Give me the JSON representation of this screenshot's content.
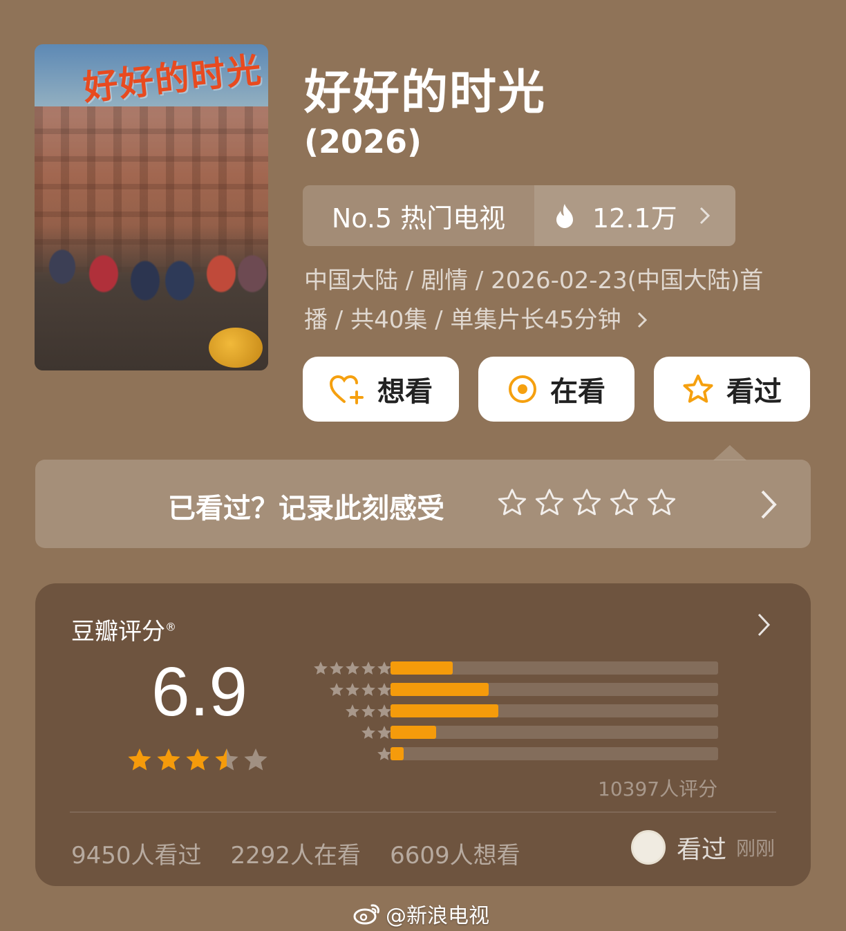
{
  "poster": {
    "title_art": "好好的时光"
  },
  "title": "好好的时光",
  "year": "(2026)",
  "rank": {
    "label": "No.5 热门电视",
    "heat": "12.1万"
  },
  "meta": {
    "line1": "中国大陆 / 剧情 / 2026-02-23(中国大陆)首",
    "line2": "播 / 共40集 / 单集片长45分钟"
  },
  "actions": {
    "want": "想看",
    "watching": "在看",
    "watched": "看过"
  },
  "record": {
    "prompt": "已看过？记录此刻感受"
  },
  "rating": {
    "title": "豆瓣评分",
    "registered": "®",
    "score": "6.9",
    "stars": 3.5,
    "distribution": [
      {
        "stars": 5,
        "percent": 19
      },
      {
        "stars": 4,
        "percent": 30
      },
      {
        "stars": 3,
        "percent": 33
      },
      {
        "stars": 2,
        "percent": 14
      },
      {
        "stars": 1,
        "percent": 4
      }
    ],
    "count": "10397人评分",
    "watched": "9450人看过",
    "watching": "2292人在看",
    "want": "6609人想看",
    "my_status": "看过",
    "my_time": "刚刚"
  },
  "watermark": "@新浪电视",
  "colors": {
    "background": "#8f7358",
    "accent": "#f59b0b",
    "card": "#6e543f"
  }
}
